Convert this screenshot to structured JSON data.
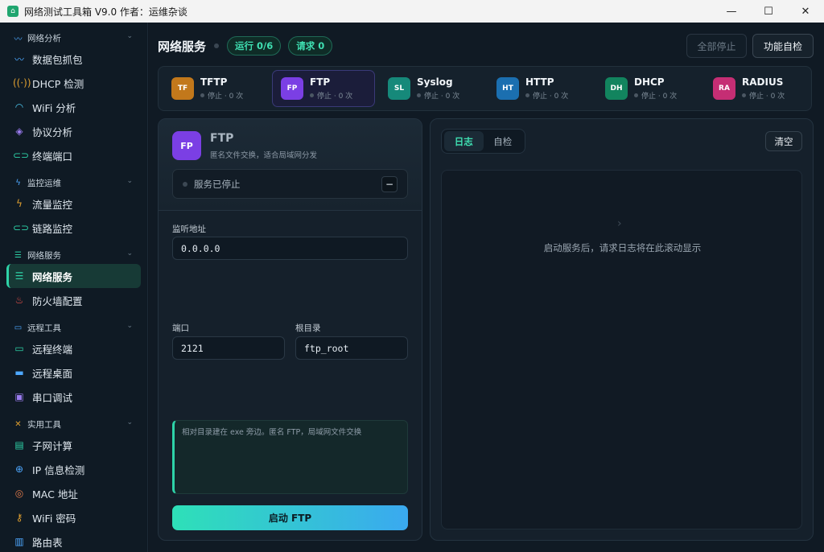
{
  "window": {
    "title": "网络测试工具箱 V9.0  作者：运维杂谈"
  },
  "sidebar": {
    "groups": [
      {
        "label": "网络分析",
        "items": [
          {
            "label": "数据包抓包"
          },
          {
            "label": "DHCP 检测"
          },
          {
            "label": "WiFi 分析"
          },
          {
            "label": "协议分析"
          },
          {
            "label": "终端端口"
          }
        ]
      },
      {
        "label": "监控运维",
        "items": [
          {
            "label": "流量监控"
          },
          {
            "label": "链路监控"
          }
        ]
      },
      {
        "label": "网络服务",
        "items": [
          {
            "label": "网络服务"
          },
          {
            "label": "防火墙配置"
          }
        ]
      },
      {
        "label": "远程工具",
        "items": [
          {
            "label": "远程终端"
          },
          {
            "label": "远程桌面"
          },
          {
            "label": "串口调试"
          }
        ]
      },
      {
        "label": "实用工具",
        "items": [
          {
            "label": "子网计算"
          },
          {
            "label": "IP 信息检测"
          },
          {
            "label": "MAC 地址"
          },
          {
            "label": "WiFi 密码"
          },
          {
            "label": "路由表"
          }
        ]
      }
    ]
  },
  "header": {
    "title": "网络服务",
    "running_pill": "运行 0/6",
    "requests_pill": "请求 0",
    "stop_all": "全部停止",
    "self_check": "功能自检"
  },
  "services": [
    {
      "badge": "TF",
      "name": "TFTP",
      "status": "停止 · 0 次",
      "color": "#c2781b"
    },
    {
      "badge": "FP",
      "name": "FTP",
      "status": "停止 · 0 次",
      "color": "#7b3fe4"
    },
    {
      "badge": "SL",
      "name": "Syslog",
      "status": "停止 · 0 次",
      "color": "#16897a"
    },
    {
      "badge": "HT",
      "name": "HTTP",
      "status": "停止 · 0 次",
      "color": "#1b6fb0"
    },
    {
      "badge": "DH",
      "name": "DHCP",
      "status": "停止 · 0 次",
      "color": "#12845e"
    },
    {
      "badge": "RA",
      "name": "RADIUS",
      "status": "停止 · 0 次",
      "color": "#c52e74"
    }
  ],
  "detail": {
    "badge": "FP",
    "title": "FTP",
    "description": "匿名文件交换，适合局域网分发",
    "status": "服务已停止",
    "status_toggle": "−",
    "listen_label": "监听地址",
    "listen_value": "0.0.0.0",
    "port_label": "端口",
    "port_value": "2121",
    "root_label": "根目录",
    "root_value": "ftp_root",
    "note": "相对目录建在 exe 旁边。匿名 FTP，局域网文件交换",
    "start_button": "启动 FTP"
  },
  "log_panel": {
    "tabs": [
      {
        "label": "日志"
      },
      {
        "label": "自检"
      }
    ],
    "clear": "清空",
    "empty_text": "启动服务后，请求日志将在此滚动显示"
  }
}
